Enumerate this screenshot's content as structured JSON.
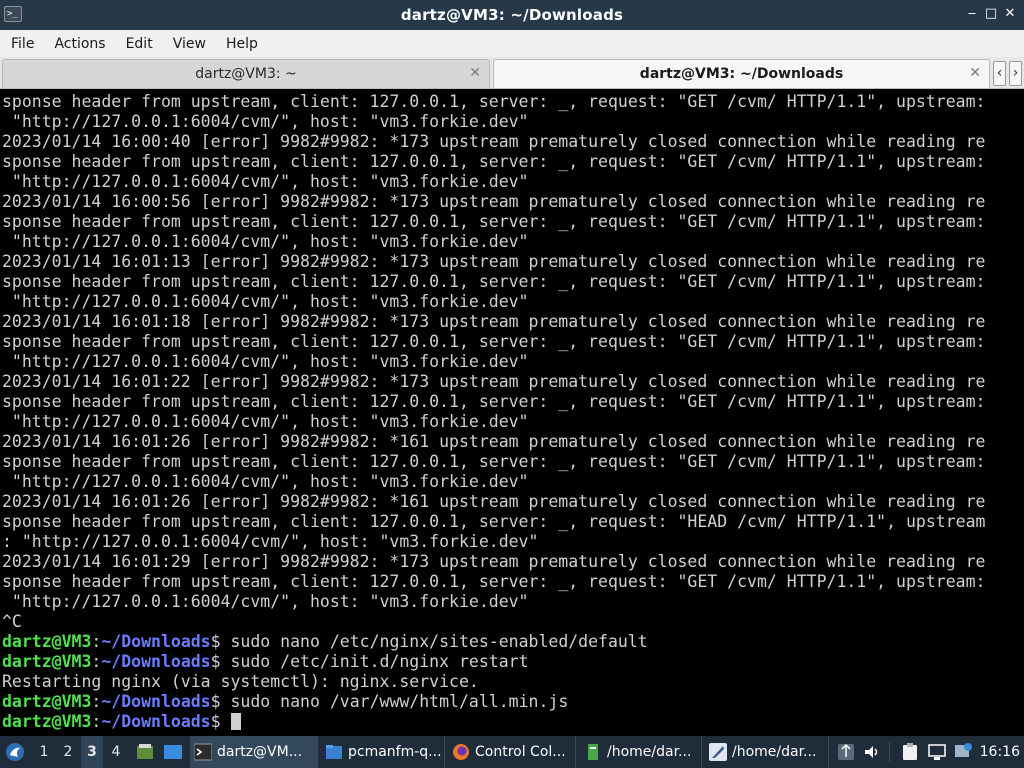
{
  "window": {
    "title": "dartz@VM3: ~/Downloads",
    "controls": {
      "minimize": "‒",
      "maximize": "□",
      "close": "✕"
    }
  },
  "menu": [
    "File",
    "Actions",
    "Edit",
    "View",
    "Help"
  ],
  "tabs": [
    {
      "label": "dartz@VM3: ~",
      "active": false
    },
    {
      "label": "dartz@VM3: ~/Downloads",
      "active": true
    }
  ],
  "tab_scroll": {
    "left": "‹",
    "right": "›"
  },
  "terminal": {
    "lines": [
      "sponse header from upstream, client: 127.0.0.1, server: _, request: \"GET /cvm/ HTTP/1.1\", upstream:",
      " \"http://127.0.0.1:6004/cvm/\", host: \"vm3.forkie.dev\"",
      "2023/01/14 16:00:40 [error] 9982#9982: *173 upstream prematurely closed connection while reading re",
      "sponse header from upstream, client: 127.0.0.1, server: _, request: \"GET /cvm/ HTTP/1.1\", upstream:",
      " \"http://127.0.0.1:6004/cvm/\", host: \"vm3.forkie.dev\"",
      "2023/01/14 16:00:56 [error] 9982#9982: *173 upstream prematurely closed connection while reading re",
      "sponse header from upstream, client: 127.0.0.1, server: _, request: \"GET /cvm/ HTTP/1.1\", upstream:",
      " \"http://127.0.0.1:6004/cvm/\", host: \"vm3.forkie.dev\"",
      "2023/01/14 16:01:13 [error] 9982#9982: *173 upstream prematurely closed connection while reading re",
      "sponse header from upstream, client: 127.0.0.1, server: _, request: \"GET /cvm/ HTTP/1.1\", upstream:",
      " \"http://127.0.0.1:6004/cvm/\", host: \"vm3.forkie.dev\"",
      "2023/01/14 16:01:18 [error] 9982#9982: *173 upstream prematurely closed connection while reading re",
      "sponse header from upstream, client: 127.0.0.1, server: _, request: \"GET /cvm/ HTTP/1.1\", upstream:",
      " \"http://127.0.0.1:6004/cvm/\", host: \"vm3.forkie.dev\"",
      "2023/01/14 16:01:22 [error] 9982#9982: *173 upstream prematurely closed connection while reading re",
      "sponse header from upstream, client: 127.0.0.1, server: _, request: \"GET /cvm/ HTTP/1.1\", upstream:",
      " \"http://127.0.0.1:6004/cvm/\", host: \"vm3.forkie.dev\"",
      "2023/01/14 16:01:26 [error] 9982#9982: *161 upstream prematurely closed connection while reading re",
      "sponse header from upstream, client: 127.0.0.1, server: _, request: \"GET /cvm/ HTTP/1.1\", upstream:",
      " \"http://127.0.0.1:6004/cvm/\", host: \"vm3.forkie.dev\"",
      "2023/01/14 16:01:26 [error] 9982#9982: *161 upstream prematurely closed connection while reading re",
      "sponse header from upstream, client: 127.0.0.1, server: _, request: \"HEAD /cvm/ HTTP/1.1\", upstream",
      ": \"http://127.0.0.1:6004/cvm/\", host: \"vm3.forkie.dev\"",
      "2023/01/14 16:01:29 [error] 9982#9982: *173 upstream prematurely closed connection while reading re",
      "sponse header from upstream, client: 127.0.0.1, server: _, request: \"GET /cvm/ HTTP/1.1\", upstream:",
      " \"http://127.0.0.1:6004/cvm/\", host: \"vm3.forkie.dev\"",
      "^C"
    ],
    "prompt": {
      "user": "dartz@VM3",
      "colon": ":",
      "path": "~/Downloads",
      "symbol": "$ "
    },
    "commands": [
      {
        "command": "sudo nano /etc/nginx/sites-enabled/default"
      },
      {
        "command": "sudo /etc/init.d/nginx restart",
        "output": "Restarting nginx (via systemctl): nginx.service."
      },
      {
        "command": "sudo nano /var/www/html/all.min.js"
      },
      {
        "command": ""
      }
    ]
  },
  "taskbar": {
    "workspaces": [
      "1",
      "2",
      "3",
      "4"
    ],
    "active_workspace": "3",
    "tasks": [
      {
        "label": "dartz@VM...",
        "icon": "terminal-icon",
        "active": true
      },
      {
        "label": "pcmanfm-q...",
        "icon": "folder-icon",
        "active": false
      },
      {
        "label": "Control Col...",
        "icon": "firefox-icon",
        "active": false
      },
      {
        "label": "/home/dar...",
        "icon": "text-editor-icon",
        "active": false
      },
      {
        "label": "/home/dar...",
        "icon": "featherpad-icon",
        "active": false
      }
    ],
    "clock": "16:16",
    "colors": {
      "bar": "#1f2c3a",
      "active": "#33485c"
    }
  },
  "colors": {
    "prompt_user": "#4ee14e",
    "prompt_path": "#6c7cff",
    "terminal_text": "#d0d0d0",
    "terminal_bg": "#000000",
    "titlebar": "#273949"
  }
}
